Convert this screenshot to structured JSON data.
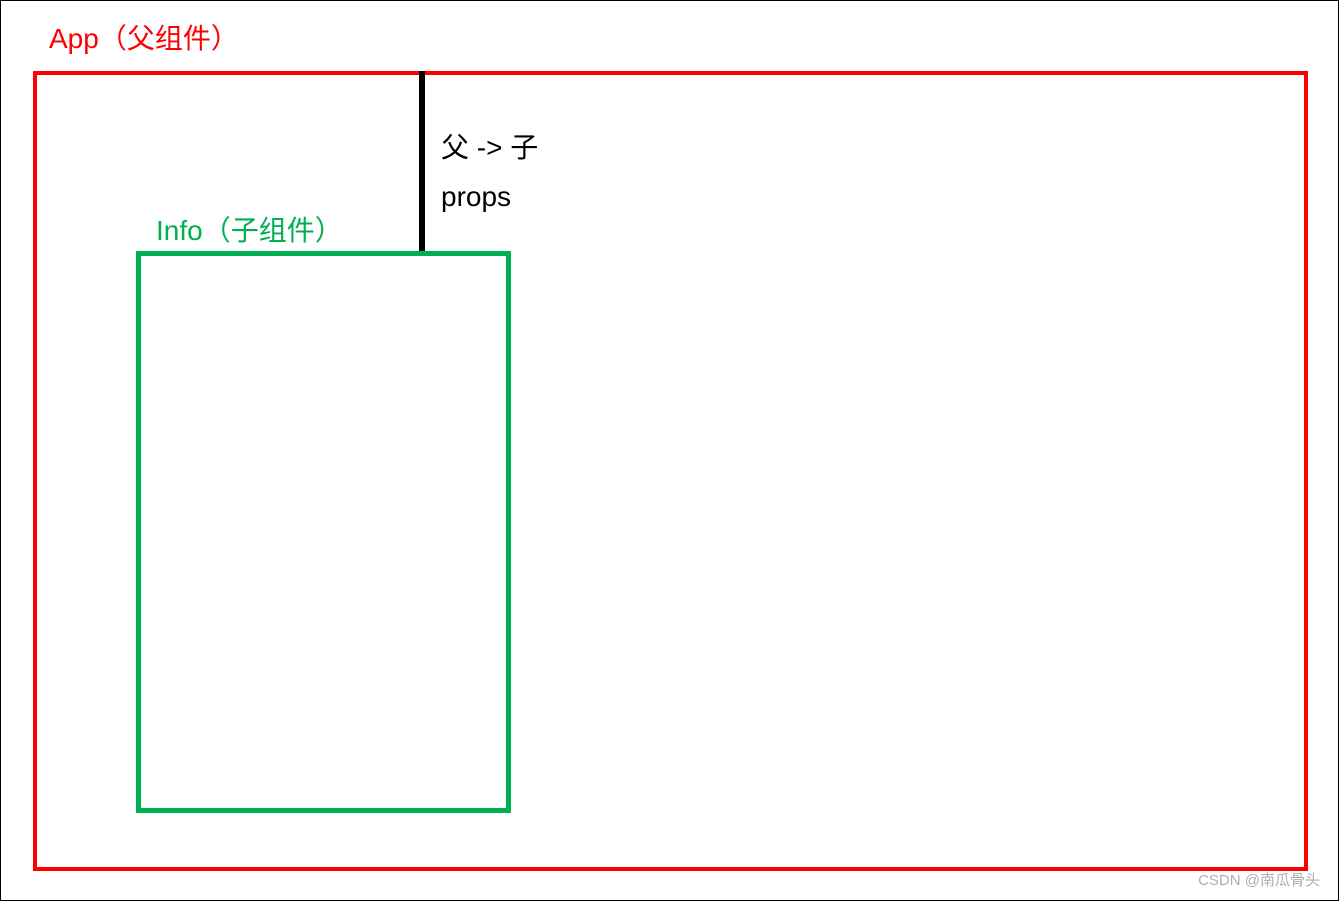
{
  "diagram": {
    "parent_label": "App（父组件）",
    "child_label": "Info（子组件）",
    "flow_direction": "父 -> 子",
    "flow_mechanism": "props",
    "colors": {
      "parent": "#ff0000",
      "child": "#00b050",
      "connector": "#000000"
    }
  },
  "watermark": "CSDN @南瓜骨头"
}
